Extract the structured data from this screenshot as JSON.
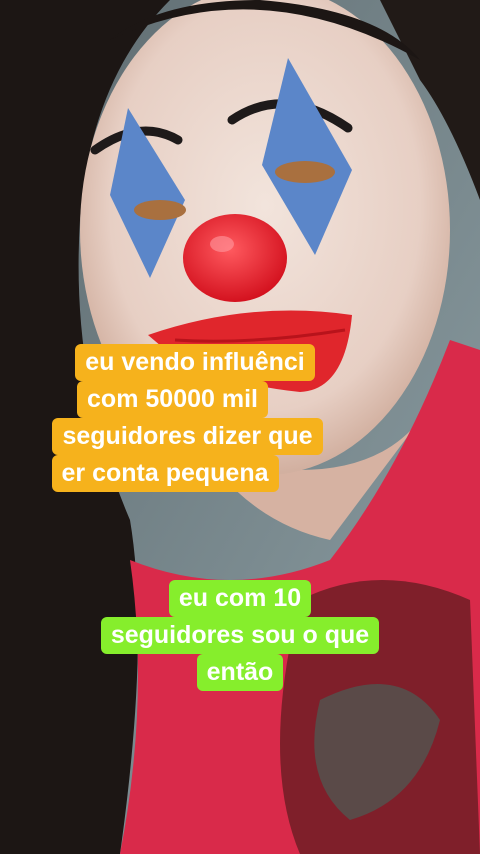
{
  "captions": {
    "top": {
      "lines": [
        "eu vendo influênci",
        "com 50000 mil",
        "seguidores dizer que",
        "er conta pequena"
      ],
      "background": "#f6b21c",
      "text_color": "#ffffff"
    },
    "bottom": {
      "lines": [
        "eu com 10",
        "seguidores sou o que",
        "então"
      ],
      "background": "#86ee2c",
      "text_color": "#ffffff"
    }
  },
  "photo": {
    "face_paint": "clown",
    "nose_color": "#e0202a",
    "eye_diamond_color": "#5b86c9",
    "shirt_color": "#d92a4a",
    "hair_color": "#1c1614"
  }
}
